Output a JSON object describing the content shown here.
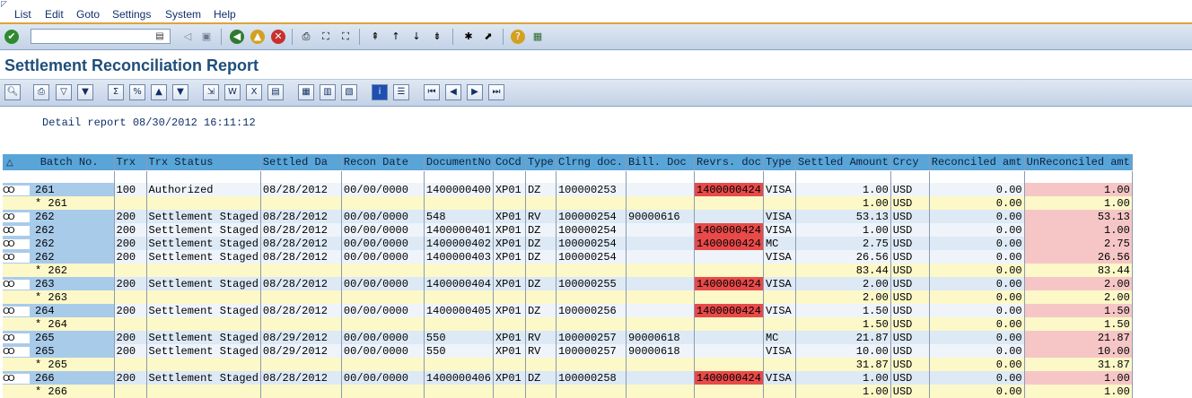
{
  "menu": {
    "items": [
      "List",
      "Edit",
      "Goto",
      "Settings",
      "System",
      "Help"
    ]
  },
  "command_field": {
    "value": ""
  },
  "title": "Settlement Reconciliation Report",
  "detail": {
    "label": "Detail report",
    "date": "08/30/2012",
    "time": "16:11:12"
  },
  "columns": [
    "Batch No.",
    "Trx",
    "Trx Status",
    "Settled Da",
    "Recon Date",
    "DocumentNo",
    "CoCd",
    "Type",
    "Clrng doc.",
    "Bill. Doc",
    "Revrs. doc",
    "Type",
    "Settled Amount",
    "Crcy",
    "Reconciled amt",
    "UnReconciled amt"
  ],
  "rows": [
    {
      "kind": "data",
      "batch": "261",
      "trx": "100",
      "status": "Authorized",
      "settled": "08/28/2012",
      "recon": "00/00/0000",
      "doc": "1400000400",
      "cocd": "XP01",
      "type": "DZ",
      "clrng": "100000253",
      "bill": "",
      "revrs": "1400000424",
      "ctype": "VISA",
      "amt": "1.00",
      "crcy": "USD",
      "rec": "0.00",
      "unrec": "1.00"
    },
    {
      "kind": "sub",
      "batch": "* 261",
      "amt": "1.00",
      "crcy": "USD",
      "rec": "0.00",
      "unrec": "1.00"
    },
    {
      "kind": "data",
      "batch": "262",
      "trx": "200",
      "status": "Settlement Staged",
      "settled": "08/28/2012",
      "recon": "00/00/0000",
      "doc": "548",
      "cocd": "XP01",
      "type": "RV",
      "clrng": "100000254",
      "bill": "90000616",
      "revrs": "",
      "ctype": "VISA",
      "amt": "53.13",
      "crcy": "USD",
      "rec": "0.00",
      "unrec": "53.13"
    },
    {
      "kind": "data",
      "batch": "262",
      "trx": "200",
      "status": "Settlement Staged",
      "settled": "08/28/2012",
      "recon": "00/00/0000",
      "doc": "1400000401",
      "cocd": "XP01",
      "type": "DZ",
      "clrng": "100000254",
      "bill": "",
      "revrs": "1400000424",
      "ctype": "VISA",
      "amt": "1.00",
      "crcy": "USD",
      "rec": "0.00",
      "unrec": "1.00"
    },
    {
      "kind": "data",
      "batch": "262",
      "trx": "200",
      "status": "Settlement Staged",
      "settled": "08/28/2012",
      "recon": "00/00/0000",
      "doc": "1400000402",
      "cocd": "XP01",
      "type": "DZ",
      "clrng": "100000254",
      "bill": "",
      "revrs": "1400000424",
      "ctype": "MC",
      "amt": "2.75",
      "crcy": "USD",
      "rec": "0.00",
      "unrec": "2.75"
    },
    {
      "kind": "data",
      "batch": "262",
      "trx": "200",
      "status": "Settlement Staged",
      "settled": "08/28/2012",
      "recon": "00/00/0000",
      "doc": "1400000403",
      "cocd": "XP01",
      "type": "DZ",
      "clrng": "100000254",
      "bill": "",
      "revrs": "",
      "ctype": "VISA",
      "amt": "26.56",
      "crcy": "USD",
      "rec": "0.00",
      "unrec": "26.56"
    },
    {
      "kind": "sub",
      "batch": "* 262",
      "amt": "83.44",
      "crcy": "USD",
      "rec": "0.00",
      "unrec": "83.44"
    },
    {
      "kind": "data",
      "batch": "263",
      "trx": "200",
      "status": "Settlement Staged",
      "settled": "08/28/2012",
      "recon": "00/00/0000",
      "doc": "1400000404",
      "cocd": "XP01",
      "type": "DZ",
      "clrng": "100000255",
      "bill": "",
      "revrs": "1400000424",
      "ctype": "VISA",
      "amt": "2.00",
      "crcy": "USD",
      "rec": "0.00",
      "unrec": "2.00"
    },
    {
      "kind": "sub",
      "batch": "* 263",
      "amt": "2.00",
      "crcy": "USD",
      "rec": "0.00",
      "unrec": "2.00"
    },
    {
      "kind": "data",
      "batch": "264",
      "trx": "200",
      "status": "Settlement Staged",
      "settled": "08/28/2012",
      "recon": "00/00/0000",
      "doc": "1400000405",
      "cocd": "XP01",
      "type": "DZ",
      "clrng": "100000256",
      "bill": "",
      "revrs": "1400000424",
      "ctype": "VISA",
      "amt": "1.50",
      "crcy": "USD",
      "rec": "0.00",
      "unrec": "1.50"
    },
    {
      "kind": "sub",
      "batch": "* 264",
      "amt": "1.50",
      "crcy": "USD",
      "rec": "0.00",
      "unrec": "1.50"
    },
    {
      "kind": "data",
      "batch": "265",
      "trx": "200",
      "status": "Settlement Staged",
      "settled": "08/29/2012",
      "recon": "00/00/0000",
      "doc": "550",
      "cocd": "XP01",
      "type": "RV",
      "clrng": "100000257",
      "bill": "90000618",
      "revrs": "",
      "ctype": "MC",
      "amt": "21.87",
      "crcy": "USD",
      "rec": "0.00",
      "unrec": "21.87"
    },
    {
      "kind": "data",
      "batch": "265",
      "trx": "200",
      "status": "Settlement Staged",
      "settled": "08/29/2012",
      "recon": "00/00/0000",
      "doc": "550",
      "cocd": "XP01",
      "type": "RV",
      "clrng": "100000257",
      "bill": "90000618",
      "revrs": "",
      "ctype": "VISA",
      "amt": "10.00",
      "crcy": "USD",
      "rec": "0.00",
      "unrec": "10.00"
    },
    {
      "kind": "sub",
      "batch": "* 265",
      "amt": "31.87",
      "crcy": "USD",
      "rec": "0.00",
      "unrec": "31.87"
    },
    {
      "kind": "data",
      "batch": "266",
      "trx": "200",
      "status": "Settlement Staged",
      "settled": "08/28/2012",
      "recon": "00/00/0000",
      "doc": "1400000406",
      "cocd": "XP01",
      "type": "DZ",
      "clrng": "100000258",
      "bill": "",
      "revrs": "1400000424",
      "ctype": "VISA",
      "amt": "1.00",
      "crcy": "USD",
      "rec": "0.00",
      "unrec": "1.00"
    },
    {
      "kind": "sub",
      "batch": "* 266",
      "amt": "1.00",
      "crcy": "USD",
      "rec": "0.00",
      "unrec": "1.00"
    }
  ],
  "colors": {
    "header": "#5aa5d8",
    "reversal_highlight": "#e84a4a",
    "unreconciled": "#f6c6c6",
    "subtotal": "#fcf8c8"
  }
}
